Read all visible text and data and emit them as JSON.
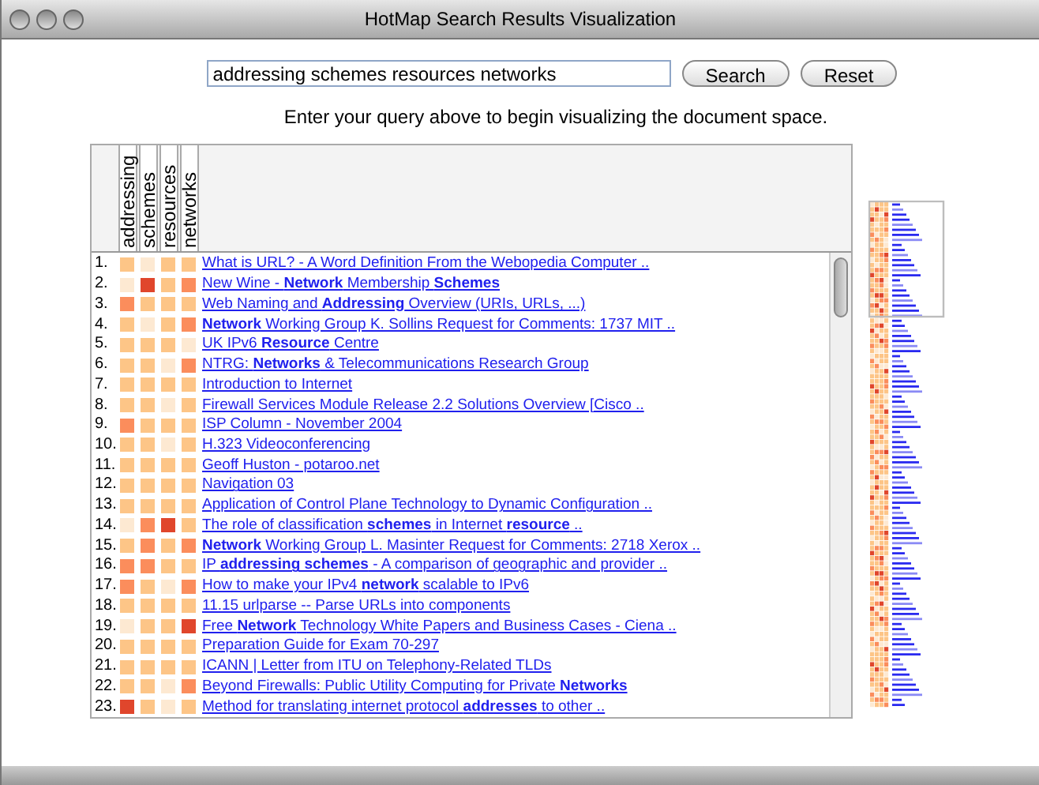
{
  "window": {
    "title": "HotMap Search Results Visualization"
  },
  "search": {
    "value": "addressing schemes resources networks",
    "buttons": [
      "Search",
      "Reset"
    ]
  },
  "caption": "Enter your query above to begin visualizing the document space.",
  "terms": [
    "addressing",
    "schemes",
    "resources",
    "networks"
  ],
  "results": [
    {
      "number": "1.",
      "heat": [
        {
          "color": "#fdc587"
        },
        {
          "color": "#fde9d2"
        },
        {
          "color": "#fdc587"
        },
        {
          "color": "#fdc587"
        }
      ],
      "title": "What is URL? - A Word Definition From the Webopedia Computer .."
    },
    {
      "number": "2.",
      "heat": [
        {
          "color": "#fde9d2"
        },
        {
          "color": "#e0462c"
        },
        {
          "color": "#fdc587"
        },
        {
          "color": "#fb8d5c"
        }
      ],
      "title": "New Wine - **Network** Membership **Schemes**"
    },
    {
      "number": "3.",
      "heat": [
        {
          "color": "#fb8d5c"
        },
        {
          "color": "#fdc587"
        },
        {
          "color": "#fdc587"
        },
        {
          "color": "#fdc587"
        }
      ],
      "title": "Web Naming and **Addressing** Overview (URIs, URLs, ...)"
    },
    {
      "number": "4.",
      "heat": [
        {
          "color": "#fdc587"
        },
        {
          "color": "#fde9d2"
        },
        {
          "color": "#fdc587"
        },
        {
          "color": "#fb8d5c"
        }
      ],
      "title": "**Network** Working Group K. Sollins Request for Comments: 1737 MIT .."
    },
    {
      "number": "5.",
      "heat": [
        {
          "color": "#fdc587"
        },
        {
          "color": "#fdc587"
        },
        {
          "color": "#fdc587"
        },
        {
          "color": "#fde9d2"
        }
      ],
      "title": "UK IPv6 **Resource** Centre"
    },
    {
      "number": "6.",
      "heat": [
        {
          "color": "#fdc587"
        },
        {
          "color": "#fdc587"
        },
        {
          "color": "#fde9d2"
        },
        {
          "color": "#fb8d5c"
        }
      ],
      "title": "NTRG: **Networks** & Telecommunications Research Group"
    },
    {
      "number": "7.",
      "heat": [
        {
          "color": "#fdc587"
        },
        {
          "color": "#fdc587"
        },
        {
          "color": "#fdc587"
        },
        {
          "color": "#fdc587"
        }
      ],
      "title": "Introduction to Internet"
    },
    {
      "number": "8.",
      "heat": [
        {
          "color": "#fdc587"
        },
        {
          "color": "#fdc587"
        },
        {
          "color": "#fde9d2"
        },
        {
          "color": "#fdc587"
        }
      ],
      "title": "Firewall Services Module Release 2.2 Solutions Overview [Cisco .."
    },
    {
      "number": "9.",
      "heat": [
        {
          "color": "#fb8d5c"
        },
        {
          "color": "#fdc587"
        },
        {
          "color": "#fdc587"
        },
        {
          "color": "#fdc587"
        }
      ],
      "title": "ISP Column - November 2004"
    },
    {
      "number": "10.",
      "heat": [
        {
          "color": "#fdc587"
        },
        {
          "color": "#fdc587"
        },
        {
          "color": "#fde9d2"
        },
        {
          "color": "#fdc587"
        }
      ],
      "title": "H.323 Videoconferencing"
    },
    {
      "number": "11.",
      "heat": [
        {
          "color": "#fdc587"
        },
        {
          "color": "#fdc587"
        },
        {
          "color": "#fdc587"
        },
        {
          "color": "#fdc587"
        }
      ],
      "title": "Geoff Huston - potaroo.net"
    },
    {
      "number": "12.",
      "heat": [
        {
          "color": "#fdc587"
        },
        {
          "color": "#fdc587"
        },
        {
          "color": "#fdc587"
        },
        {
          "color": "#fdc587"
        }
      ],
      "title": "Navigation 03"
    },
    {
      "number": "13.",
      "heat": [
        {
          "color": "#fdc587"
        },
        {
          "color": "#fdc587"
        },
        {
          "color": "#fdc587"
        },
        {
          "color": "#fdc587"
        }
      ],
      "title": "Application of Control Plane Technology to Dynamic Configuration .."
    },
    {
      "number": "14.",
      "heat": [
        {
          "color": "#fde9d2"
        },
        {
          "color": "#fb8d5c"
        },
        {
          "color": "#e0462c"
        },
        {
          "color": "#fdc587"
        }
      ],
      "title": "The role of classification **schemes** in Internet **resource** .."
    },
    {
      "number": "15.",
      "heat": [
        {
          "color": "#fdc587"
        },
        {
          "color": "#fb8d5c"
        },
        {
          "color": "#fdc587"
        },
        {
          "color": "#fb8d5c"
        }
      ],
      "title": "**Network** Working Group L. Masinter Request for Comments: 2718 Xerox .."
    },
    {
      "number": "16.",
      "heat": [
        {
          "color": "#fb8d5c"
        },
        {
          "color": "#fb8d5c"
        },
        {
          "color": "#fdc587"
        },
        {
          "color": "#fdc587"
        }
      ],
      "title": "IP **addressing schemes** - A comparison of geographic and provider .."
    },
    {
      "number": "17.",
      "heat": [
        {
          "color": "#fb8d5c"
        },
        {
          "color": "#fdc587"
        },
        {
          "color": "#fde9d2"
        },
        {
          "color": "#fb8d5c"
        }
      ],
      "title": "How to make your IPv4 **network** scalable to IPv6"
    },
    {
      "number": "18.",
      "heat": [
        {
          "color": "#fdc587"
        },
        {
          "color": "#fdc587"
        },
        {
          "color": "#fdc587"
        },
        {
          "color": "#fdc587"
        }
      ],
      "title": "11.15 urlparse -- Parse URLs into components"
    },
    {
      "number": "19.",
      "heat": [
        {
          "color": "#fde9d2"
        },
        {
          "color": "#fdc587"
        },
        {
          "color": "#fdc587"
        },
        {
          "color": "#e0462c"
        }
      ],
      "title": "Free **Network** Technology White Papers and Business Cases - Ciena .."
    },
    {
      "number": "20.",
      "heat": [
        {
          "color": "#fdc587"
        },
        {
          "color": "#fdc587"
        },
        {
          "color": "#fdc587"
        },
        {
          "color": "#fdc587"
        }
      ],
      "title": "Preparation Guide for Exam 70-297"
    },
    {
      "number": "21.",
      "heat": [
        {
          "color": "#fdc587"
        },
        {
          "color": "#fdc587"
        },
        {
          "color": "#fdc587"
        },
        {
          "color": "#fdc587"
        }
      ],
      "title": "ICANN | Letter from ITU on Telephony-Related TLDs"
    },
    {
      "number": "22.",
      "heat": [
        {
          "color": "#fdc587"
        },
        {
          "color": "#fdc587"
        },
        {
          "color": "#fde9d2"
        },
        {
          "color": "#fb8d5c"
        }
      ],
      "title": "Beyond Firewalls: Public Utility Computing for Private **Networks**"
    },
    {
      "number": "23.",
      "heat": [
        {
          "color": "#e0462c"
        },
        {
          "color": "#fdc587"
        },
        {
          "color": "#fde9d2"
        },
        {
          "color": "#fdc587"
        }
      ],
      "title": "Method for translating internet protocol **addresses** to other .."
    }
  ]
}
